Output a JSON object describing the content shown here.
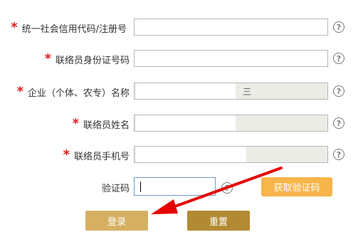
{
  "form": {
    "fields": [
      {
        "required_mark": "*",
        "label": "统一社会信用代码/注册号",
        "value": ""
      },
      {
        "required_mark": "*",
        "label": "联络员身份证号码",
        "value": ""
      },
      {
        "required_mark": "*",
        "label": "企业（个体、农专）名称",
        "value": "三"
      },
      {
        "required_mark": "*",
        "label": "联络员姓名",
        "value": ""
      },
      {
        "required_mark": "*",
        "label": "联络员手机号",
        "value": ""
      }
    ],
    "captcha": {
      "label": "验证码",
      "value": ""
    },
    "help_glyph": "?",
    "get_code_button": "获取验证码",
    "login_button": "登录",
    "reset_button": "重置"
  },
  "colors": {
    "required": "#e01b1b",
    "get_code_button": "#f7b54a",
    "login_button": "#d6b062",
    "reset_button": "#b38a34",
    "annotation_arrow": "#e60000"
  },
  "icons": {
    "help": "question-circle-icon",
    "annotation": "red-arrow-annotation"
  }
}
